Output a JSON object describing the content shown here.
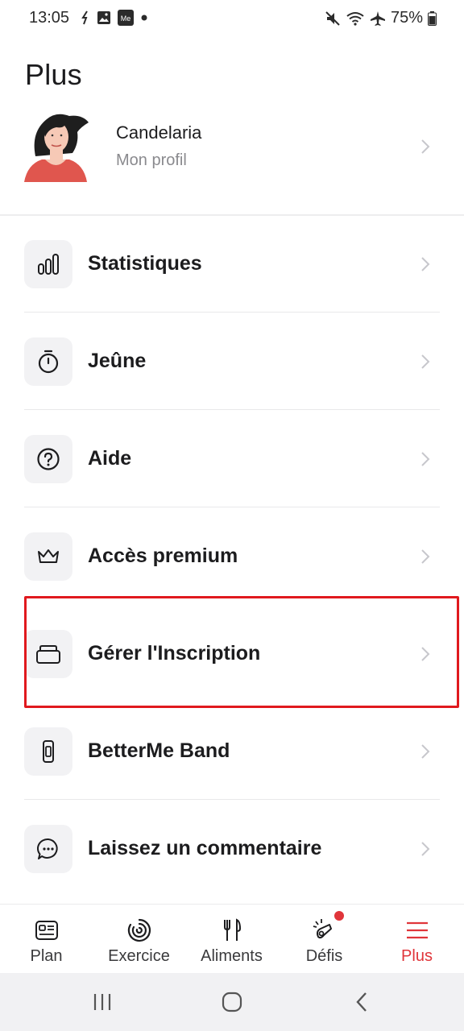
{
  "status_bar": {
    "time": "13:05",
    "battery": "75%",
    "left_icons": [
      "call-forward-icon",
      "image-icon",
      "me-app-icon",
      "dot-icon"
    ],
    "right_icons": [
      "mute-icon",
      "wifi-icon",
      "airplane-icon",
      "battery-icon"
    ]
  },
  "page": {
    "title": "Plus"
  },
  "profile": {
    "name": "Candelaria",
    "subtitle": "Mon profil"
  },
  "menu": {
    "items": [
      {
        "label": "Statistiques",
        "icon": "bar-chart-icon"
      },
      {
        "label": "Jeûne",
        "icon": "timer-icon"
      },
      {
        "label": "Aide",
        "icon": "help-icon"
      },
      {
        "label": "Accès premium",
        "icon": "crown-icon"
      },
      {
        "label": "Gérer l'Inscription",
        "icon": "subscription-card-icon",
        "highlighted": true
      },
      {
        "label": "BetterMe Band",
        "icon": "band-icon"
      },
      {
        "label": "Laissez un commentaire",
        "icon": "comment-icon"
      }
    ]
  },
  "tabs": [
    {
      "label": "Plan",
      "icon": "plan-icon",
      "active": false
    },
    {
      "label": "Exercice",
      "icon": "exercise-icon",
      "active": false
    },
    {
      "label": "Aliments",
      "icon": "utensils-icon",
      "active": false
    },
    {
      "label": "Défis",
      "icon": "challenges-icon",
      "active": false,
      "badge": true
    },
    {
      "label": "Plus",
      "icon": "menu-icon",
      "active": true
    }
  ],
  "colors": {
    "accent": "#e0353a",
    "highlight_border": "#e0191e",
    "icon_bg": "#f2f2f4"
  },
  "system_nav": [
    "recent-apps-icon",
    "home-icon",
    "back-icon"
  ]
}
